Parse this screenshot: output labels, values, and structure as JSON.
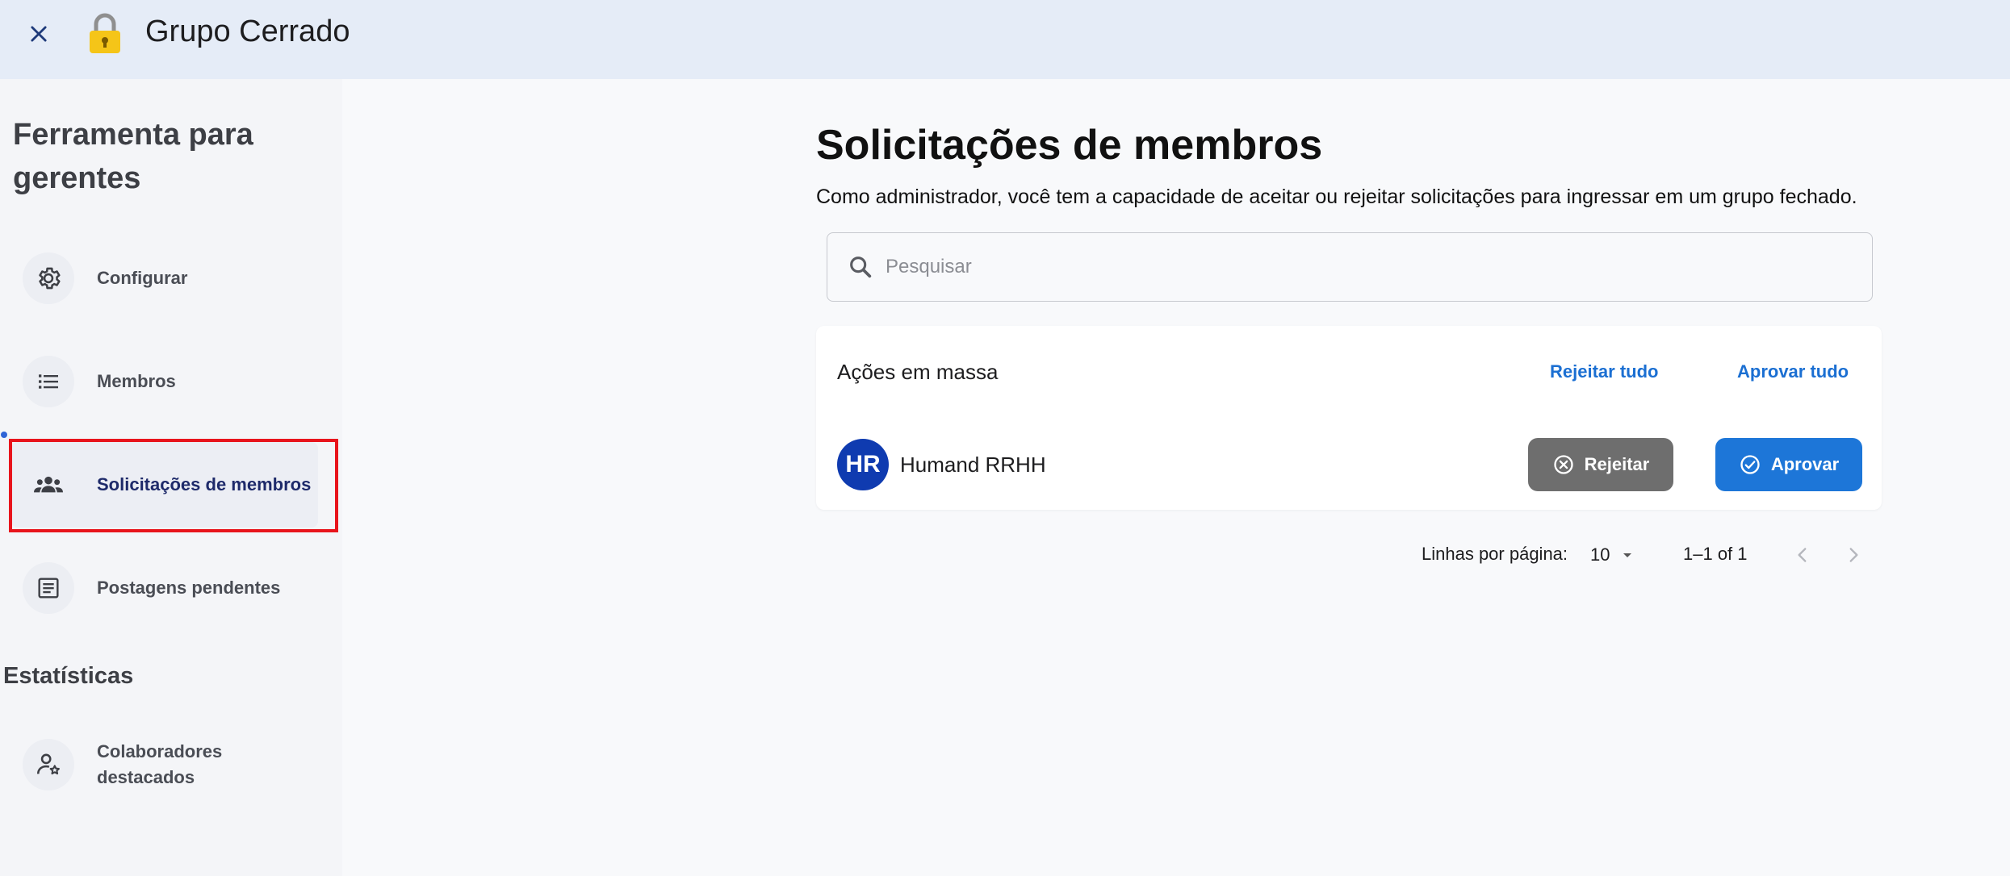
{
  "header": {
    "title": "Grupo Cerrado"
  },
  "sidebar": {
    "title": "Ferramenta para gerentes",
    "items": [
      {
        "label": "Configurar",
        "icon": "gear-icon"
      },
      {
        "label": "Membros",
        "icon": "list-icon"
      },
      {
        "label": "Solicitações de membros",
        "icon": "group-icon",
        "active": true
      },
      {
        "label": "Postagens pendentes",
        "icon": "document-icon"
      }
    ],
    "stats_title": "Estatísticas",
    "stats_items": [
      {
        "label": "Colaboradores destacados",
        "icon": "person-star-icon"
      }
    ]
  },
  "main": {
    "title": "Solicitações de membros",
    "description": "Como administrador, você tem a capacidade de aceitar ou rejeitar solicitações para ingressar em um grupo fechado.",
    "search": {
      "placeholder": "Pesquisar"
    },
    "bulk": {
      "title": "Ações em massa",
      "reject_all": "Rejeitar tudo",
      "approve_all": "Aprovar tudo"
    },
    "requests": [
      {
        "initials": "HR",
        "name": "Humand RRHH",
        "reject_label": "Rejeitar",
        "approve_label": "Aprovar"
      }
    ],
    "pagination": {
      "rows_label": "Linhas por página:",
      "rows_value": "10",
      "range": "1–1 of 1"
    }
  },
  "colors": {
    "accent": "#1d76d8",
    "avatar": "#0f3bb0",
    "reject": "#6e6e6e",
    "highlight": "#e8141c"
  }
}
